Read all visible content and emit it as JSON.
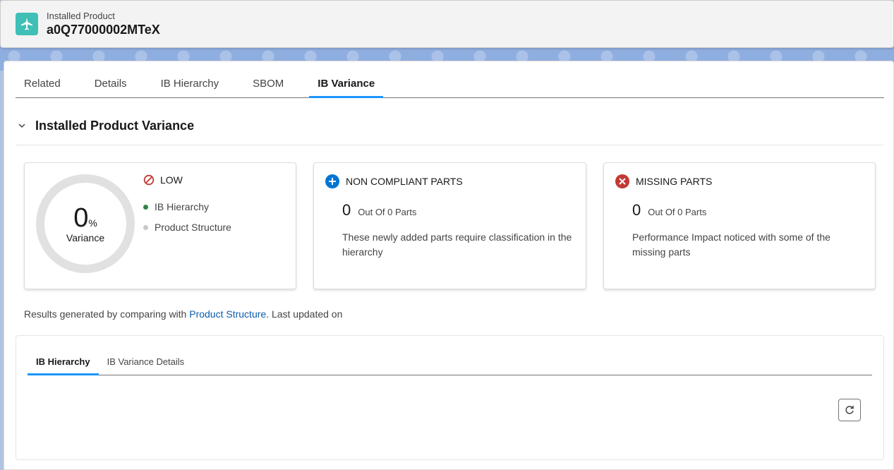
{
  "header": {
    "record_type": "Installed Product",
    "record_name": "a0Q77000002MTeX",
    "icon": "airplane-icon"
  },
  "tabs": [
    {
      "label": "Related",
      "active": false
    },
    {
      "label": "Details",
      "active": false
    },
    {
      "label": "IB Hierarchy",
      "active": false
    },
    {
      "label": "SBOM",
      "active": false
    },
    {
      "label": "IB Variance",
      "active": true
    }
  ],
  "section": {
    "title": "Installed Product Variance"
  },
  "variance_card": {
    "value": "0",
    "unit": "%",
    "label": "Variance",
    "risk_level": "LOW",
    "legend": [
      {
        "label": "IB Hierarchy",
        "color": "#2e844a"
      },
      {
        "label": "Product Structure",
        "color": "#c9c9c9"
      }
    ]
  },
  "non_compliant_card": {
    "title": "NON COMPLIANT PARTS",
    "count": "0",
    "count_label": "Out Of 0 Parts",
    "description": "These newly added parts require classification in the hierarchy",
    "icon_color": "#0176d3"
  },
  "missing_card": {
    "title": "MISSING PARTS",
    "count": "0",
    "count_label": "Out Of 0 Parts",
    "description": "Performance Impact noticed with some of the missing parts",
    "icon_color": "#c23934"
  },
  "results": {
    "prefix": "Results generated by comparing with ",
    "link": "Product Structure",
    "suffix": ". Last updated on"
  },
  "inner_tabs": [
    {
      "label": "IB Hierarchy",
      "active": true
    },
    {
      "label": "IB Variance Details",
      "active": false
    }
  ],
  "colors": {
    "accent": "#1b96ff",
    "record_icon_bg": "#3fbfb6"
  }
}
